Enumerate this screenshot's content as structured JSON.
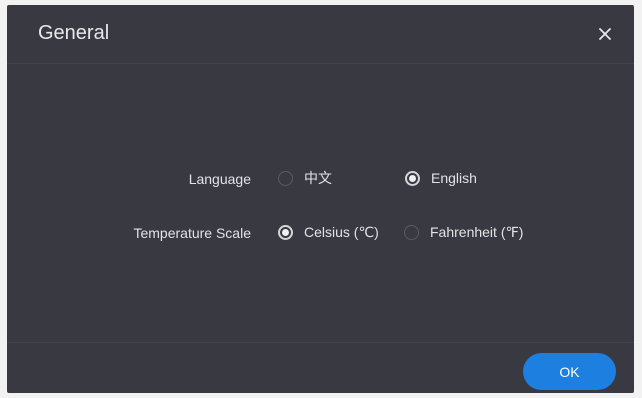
{
  "dialog": {
    "title": "General",
    "close_icon": "close-icon"
  },
  "language": {
    "label": "Language",
    "options": [
      {
        "label": "中文",
        "checked": false
      },
      {
        "label": "English",
        "checked": true
      }
    ]
  },
  "temperature": {
    "label": "Temperature Scale",
    "options": [
      {
        "label": "Celsius (℃)",
        "checked": true
      },
      {
        "label": "Fahrenheit (℉)",
        "checked": false
      }
    ]
  },
  "footer": {
    "ok_label": "OK"
  },
  "colors": {
    "dialog_bg": "#393942",
    "accent": "#1d7fe0",
    "text": "#e2e2e6"
  }
}
